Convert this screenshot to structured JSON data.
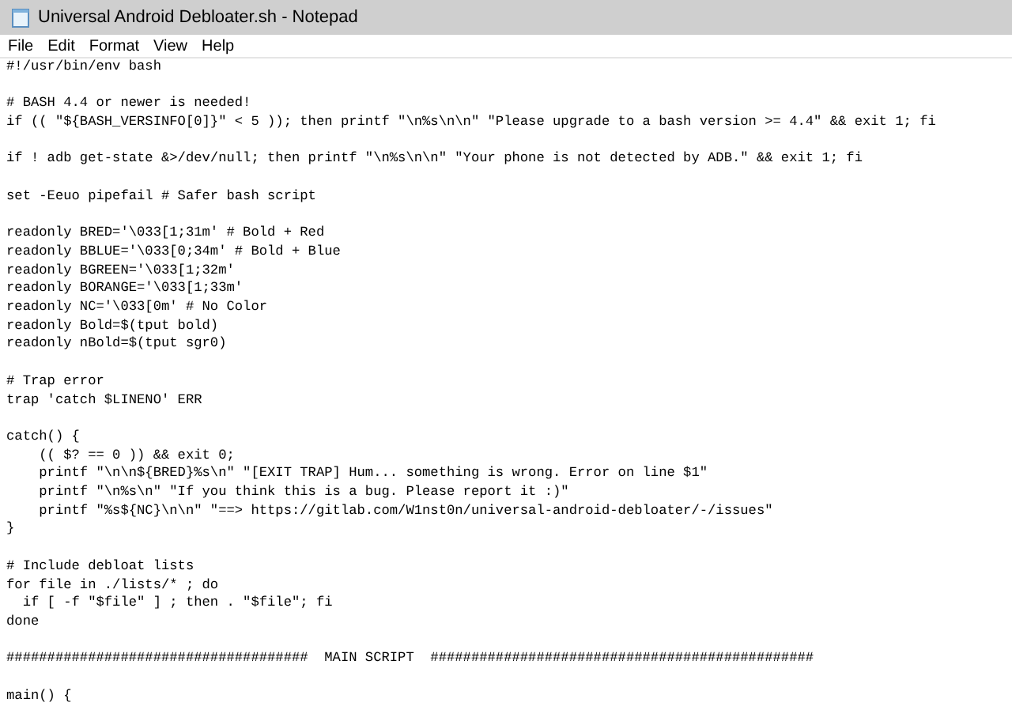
{
  "window": {
    "title": "Universal Android Debloater.sh - Notepad"
  },
  "menu": [
    "File",
    "Edit",
    "Format",
    "View",
    "Help"
  ],
  "editor": {
    "blocks": [
      [
        "#!/usr/bin/env bash"
      ],
      [
        "# BASH 4.4 or newer is needed!",
        "if (( \"${BASH_VERSINFO[0]}\" < 5 )); then printf \"\\n%s\\n\\n\" \"Please upgrade to a bash version >= 4.4\" && exit 1; fi"
      ],
      [
        "if ! adb get-state &>/dev/null; then printf \"\\n%s\\n\\n\" \"Your phone is not detected by ADB.\" && exit 1; fi"
      ],
      [
        "set -Eeuo pipefail # Safer bash script"
      ],
      [
        "readonly BRED='\\033[1;31m' # Bold + Red",
        "readonly BBLUE='\\033[0;34m' # Bold + Blue",
        "readonly BGREEN='\\033[1;32m'",
        "readonly BORANGE='\\033[1;33m'",
        "readonly NC='\\033[0m' # No Color",
        "readonly Bold=$(tput bold)",
        "readonly nBold=$(tput sgr0)"
      ],
      [
        "# Trap error",
        "trap 'catch $LINENO' ERR"
      ],
      [
        "catch() {",
        "    (( $? == 0 )) && exit 0;",
        "    printf \"\\n\\n${BRED}%s\\n\" \"[EXIT TRAP] Hum... something is wrong. Error on line $1\"",
        "    printf \"\\n%s\\n\" \"If you think this is a bug. Please report it :)\"",
        "    printf \"%s${NC}\\n\\n\" \"==> https://gitlab.com/W1nst0n/universal-android-debloater/-/issues\"",
        "}"
      ],
      [
        "# Include debloat lists",
        "for file in ./lists/* ; do",
        "  if [ -f \"$file\" ] ; then . \"$file\"; fi",
        "done"
      ],
      [
        "#####################################  MAIN SCRIPT  ###############################################"
      ],
      [
        "main() {"
      ]
    ]
  }
}
